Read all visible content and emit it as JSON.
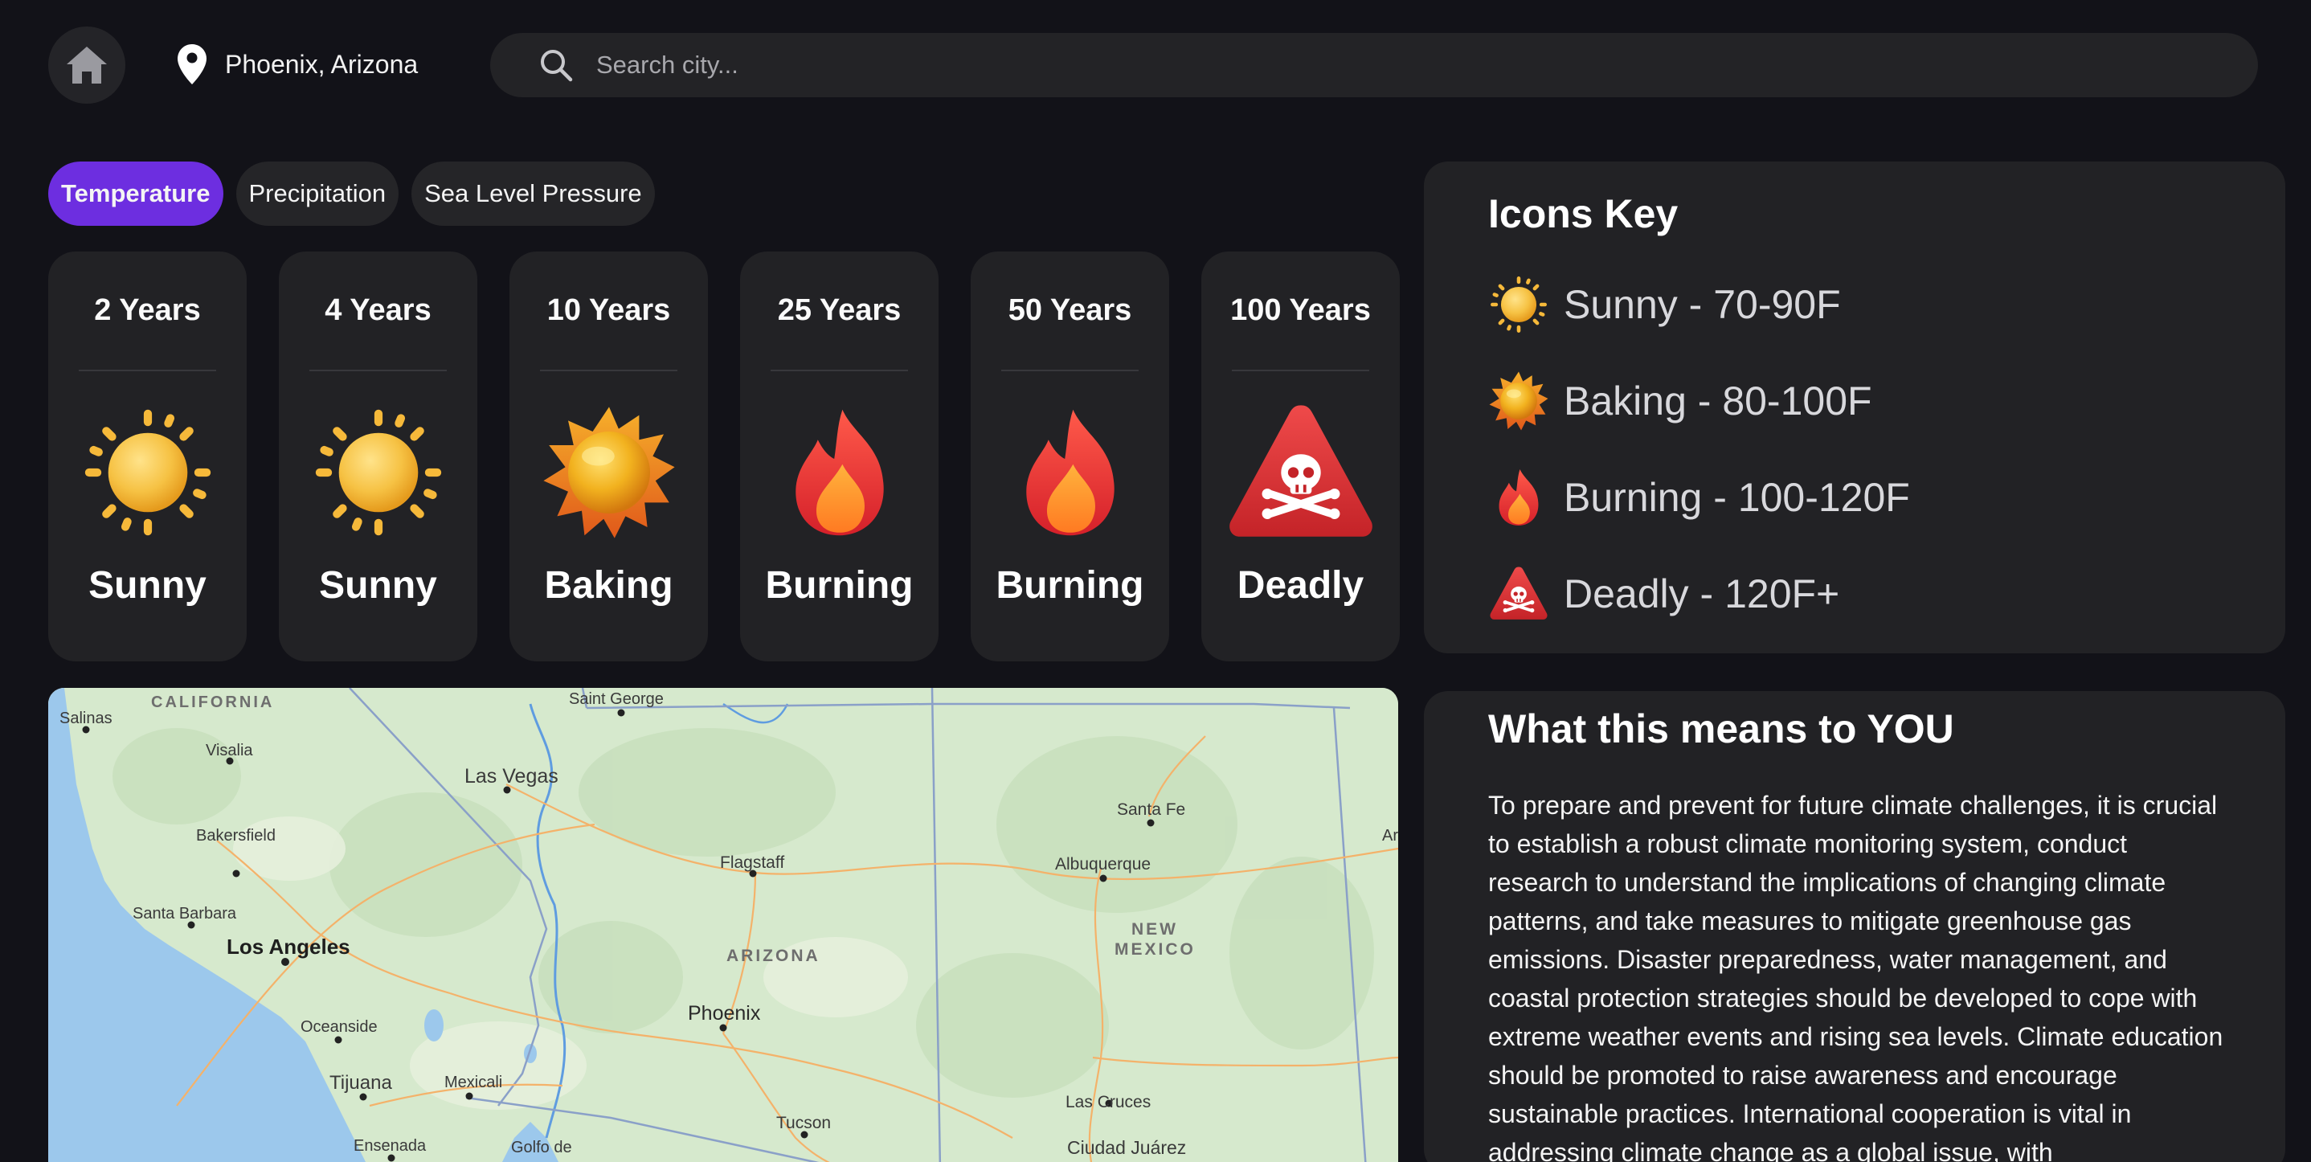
{
  "header": {
    "location": "Phoenix, Arizona",
    "search_placeholder": "Search city..."
  },
  "tabs": [
    {
      "label": "Temperature",
      "active": true
    },
    {
      "label": "Precipitation",
      "active": false
    },
    {
      "label": "Sea Level Pressure",
      "active": false
    }
  ],
  "forecast": [
    {
      "years": "2 Years",
      "status": "Sunny",
      "icon": "sunny-icon"
    },
    {
      "years": "4 Years",
      "status": "Sunny",
      "icon": "sunny-icon"
    },
    {
      "years": "10 Years",
      "status": "Baking",
      "icon": "baking-sun-icon"
    },
    {
      "years": "25 Years",
      "status": "Burning",
      "icon": "fire-icon"
    },
    {
      "years": "50 Years",
      "status": "Burning",
      "icon": "fire-icon"
    },
    {
      "years": "100 Years",
      "status": "Deadly",
      "icon": "skull-warning-icon"
    }
  ],
  "icons_key": {
    "title": "Icons Key",
    "items": [
      {
        "label": "Sunny - 70-90F",
        "icon": "sunny-icon"
      },
      {
        "label": "Baking - 80-100F",
        "icon": "baking-sun-icon"
      },
      {
        "label": "Burning - 100-120F",
        "icon": "fire-icon"
      },
      {
        "label": "Deadly - 120F+",
        "icon": "skull-warning-icon"
      }
    ]
  },
  "meaning": {
    "title": "What this means to YOU",
    "body": "To prepare and prevent for future climate challenges, it is crucial to establish a robust climate monitoring system, conduct research to understand the implications of changing climate patterns, and take measures to mitigate greenhouse gas emissions. Disaster preparedness, water management, and coastal protection strategies should be developed to cope with extreme weather events and rising sea levels. Climate education should be promoted to raise awareness and encourage sustainable practices. International cooperation is vital in addressing climate change as a global issue, with"
  },
  "map": {
    "labels": {
      "salinas": "Salinas",
      "california": "CALIFORNIA",
      "saint_george": "Saint George",
      "visalia": "Visalia",
      "las_vegas": "Las Vegas",
      "santa_fe": "Santa Fe",
      "bakersfield": "Bakersfield",
      "flagstaff": "Flagstaff",
      "albuquerque": "Albuquerque",
      "santa_barbara": "Santa Barbara",
      "new": "NEW",
      "mexico": "MEXICO",
      "los_angeles": "Los Angeles",
      "arizona": "ARIZONA",
      "phoenix": "Phoenix",
      "oceanside": "Oceanside",
      "tijuana": "Tijuana",
      "mexicali": "Mexicali",
      "las_cruces": "Las Cruces",
      "tucson": "Tucson",
      "ensenada": "Ensenada",
      "golfo_de": "Golfo de",
      "ciudad_juarez": "Ciudad Juárez",
      "am_partial": "Ar"
    }
  },
  "colors": {
    "background": "#121218",
    "panel": "#222225",
    "accent": "#6d2ee0"
  }
}
